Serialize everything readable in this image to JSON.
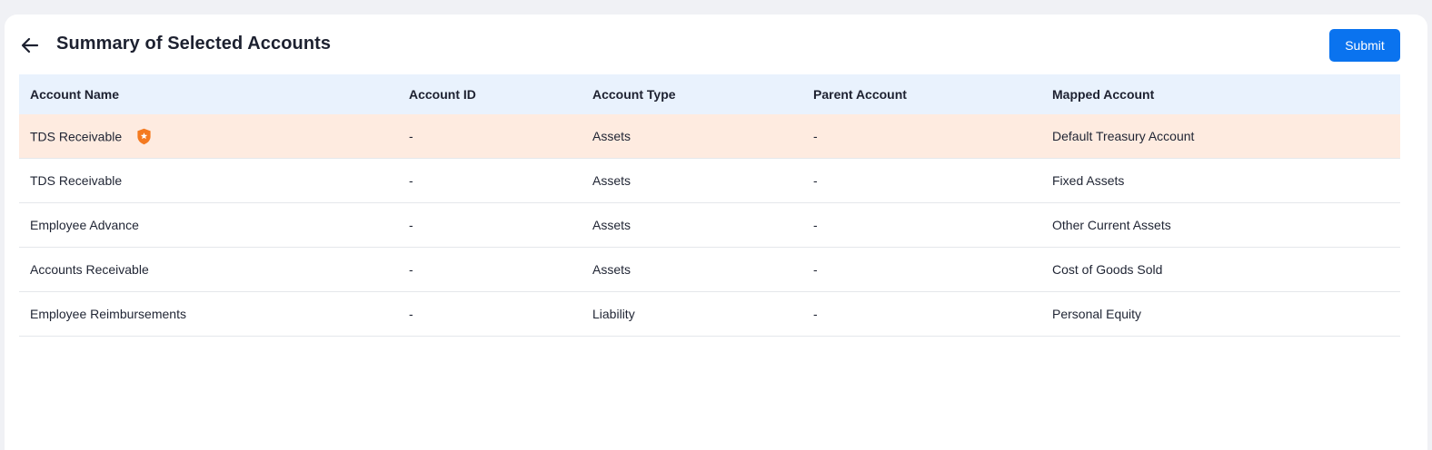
{
  "header": {
    "title": "Summary of Selected Accounts",
    "submit_label": "Submit"
  },
  "table": {
    "columns": [
      "Account Name",
      "Account ID",
      "Account Type",
      "Parent Account",
      "Mapped Account"
    ],
    "rows": [
      {
        "name": "TDS Receivable",
        "id": "-",
        "type": "Assets",
        "parent": "-",
        "mapped": "Default Treasury Account",
        "highlighted": true,
        "badge": "default-badge-icon"
      },
      {
        "name": "TDS Receivable",
        "id": "-",
        "type": "Assets",
        "parent": "-",
        "mapped": "Fixed Assets"
      },
      {
        "name": "Employee Advance",
        "id": "-",
        "type": "Assets",
        "parent": "-",
        "mapped": "Other Current Assets"
      },
      {
        "name": "Accounts Receivable",
        "id": "-",
        "type": "Assets",
        "parent": "-",
        "mapped": "Cost of Goods Sold"
      },
      {
        "name": "Employee Reimbursements",
        "id": "-",
        "type": "Liability",
        "parent": "-",
        "mapped": "Personal Equity"
      }
    ]
  },
  "colors": {
    "accent": "#0a73ef",
    "header_bg": "#e9f2fd",
    "highlight_bg": "#feebe0",
    "badge": "#f47a20"
  },
  "icons": {
    "back": "arrow-left-icon",
    "badge": "shield-star-icon"
  }
}
